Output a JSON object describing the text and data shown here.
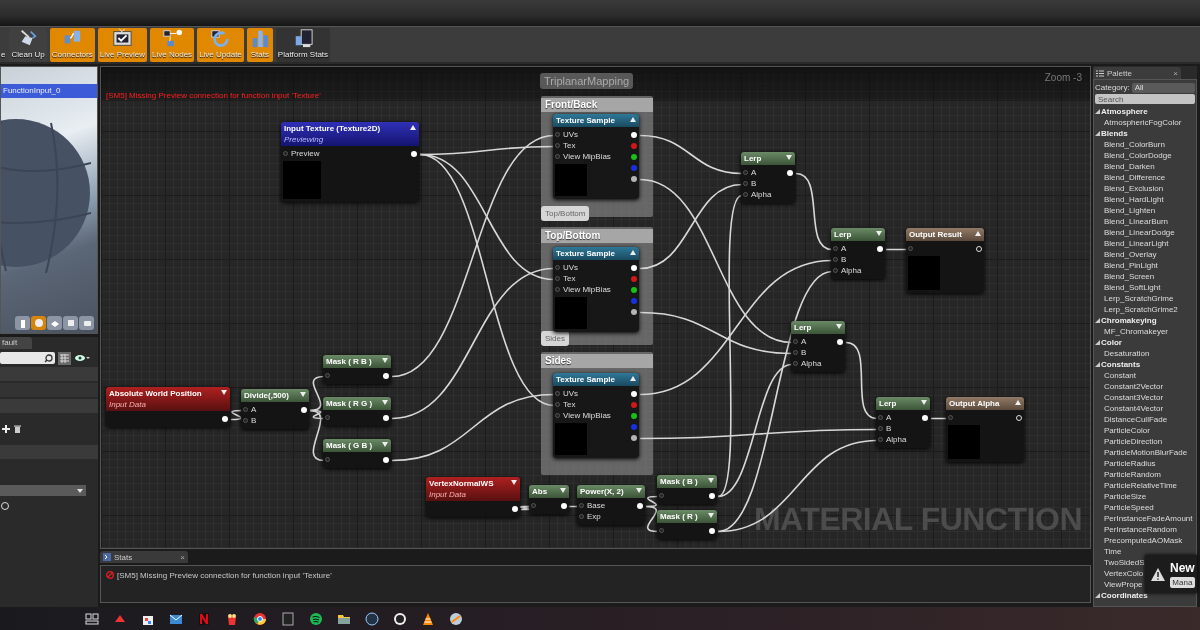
{
  "toolbar": {
    "buttons": [
      {
        "label": "e",
        "active": false
      },
      {
        "label": "Clean Up",
        "active": false
      },
      {
        "label": "Connectors",
        "active": true
      },
      {
        "label": "Live Preview",
        "active": true
      },
      {
        "label": "Live Nodes",
        "active": true
      },
      {
        "label": "Live Update",
        "active": true
      },
      {
        "label": "Stats",
        "active": true
      },
      {
        "label": "Platform Stats",
        "active": false
      }
    ]
  },
  "viewport": {
    "title": "FunctionInput_0",
    "view_modes": [
      {
        "selected": false
      },
      {
        "selected": true
      },
      {
        "selected": false
      },
      {
        "selected": false
      },
      {
        "selected": false
      }
    ]
  },
  "details": {
    "tab": "fault",
    "radio_selected": false
  },
  "graph": {
    "error": "[SM5] Missing Preview connection for function input 'Texture'",
    "zoom": "Zoom -3",
    "watermark": "MATERIAL FUNCTION",
    "group_title": "TriplanarMapping",
    "comments": [
      {
        "title": "Front/Back"
      },
      {
        "title": "Top/Bottom",
        "bubble": "Top/Bottom"
      },
      {
        "title": "Sides",
        "bubble": "Sides"
      }
    ],
    "nodes": [
      {
        "kind": "parameter",
        "title": "Input Texture (Texture2D)",
        "subtitle": "Previewing",
        "inputs": [
          "Preview"
        ]
      },
      {
        "kind": "texture",
        "title": "Texture Sample",
        "inputs": [
          "UVs",
          "Tex",
          "View MipBias"
        ],
        "outputs": [
          {
            "color": "#ffffff"
          },
          {
            "color": "#d01818"
          },
          {
            "color": "#18c018"
          },
          {
            "color": "#1830e0"
          },
          {
            "color": "#b4b4b4"
          }
        ]
      },
      {
        "kind": "math",
        "title": "Lerp",
        "inputs": [
          "A",
          "B",
          "Alpha"
        ]
      },
      {
        "kind": "texture",
        "title": "Texture Sample",
        "inputs": [
          "UVs",
          "Tex",
          "View MipBias"
        ],
        "outputs": [
          {
            "color": "#ffffff"
          },
          {
            "color": "#d01818"
          },
          {
            "color": "#18c018"
          },
          {
            "color": "#1830e0"
          },
          {
            "color": "#b4b4b4"
          }
        ]
      },
      {
        "kind": "math",
        "title": "Lerp",
        "inputs": [
          "A",
          "B",
          "Alpha"
        ]
      },
      {
        "kind": "output",
        "title": "Output Result"
      },
      {
        "kind": "math",
        "title": "Mask ( R B )"
      },
      {
        "kind": "math",
        "title": "Lerp",
        "inputs": [
          "A",
          "B",
          "Alpha"
        ]
      },
      {
        "kind": "input",
        "title": "Absolute World Position",
        "subtitle": "Input Data"
      },
      {
        "kind": "math",
        "title": "Divide(,500)",
        "inputs": [
          "A",
          "B"
        ]
      },
      {
        "kind": "math",
        "title": "Mask ( R G )"
      },
      {
        "kind": "math",
        "title": "Mask ( G B )"
      },
      {
        "kind": "texture",
        "title": "Texture Sample",
        "inputs": [
          "UVs",
          "Tex",
          "View MipBias"
        ],
        "outputs": [
          {
            "color": "#ffffff"
          },
          {
            "color": "#d01818"
          },
          {
            "color": "#18c018"
          },
          {
            "color": "#1830e0"
          },
          {
            "color": "#b4b4b4"
          }
        ]
      },
      {
        "kind": "math",
        "title": "Lerp",
        "inputs": [
          "A",
          "B",
          "Alpha"
        ]
      },
      {
        "kind": "output",
        "title": "Output Alpha"
      },
      {
        "kind": "input",
        "title": "VertexNormalWS",
        "subtitle": "Input Data"
      },
      {
        "kind": "math",
        "title": "Abs"
      },
      {
        "kind": "math",
        "title": "Power(X, 2)",
        "inputs": [
          "Base",
          "Exp"
        ]
      },
      {
        "kind": "math",
        "title": "Mask ( B )"
      },
      {
        "kind": "math",
        "title": "Mask ( R )"
      }
    ]
  },
  "log": {
    "tab": "Stats",
    "close": "×",
    "message": "[SM5] Missing Preview connection for function input 'Texture'"
  },
  "palette": {
    "tab": "Palette",
    "close": "×",
    "category_label": "Category:",
    "category": "All",
    "search_placeholder": "Search",
    "items": [
      {
        "label": "Atmosphere",
        "expanded": true,
        "children": [
          {
            "label": "AtmosphericFogColor"
          }
        ]
      },
      {
        "label": "Blends",
        "expanded": true,
        "children": [
          {
            "label": "Blend_ColorBurn"
          },
          {
            "label": "Blend_ColorDodge"
          },
          {
            "label": "Blend_Darken"
          },
          {
            "label": "Blend_Difference"
          },
          {
            "label": "Blend_Exclusion"
          },
          {
            "label": "Blend_HardLight"
          },
          {
            "label": "Blend_Lighten"
          },
          {
            "label": "Blend_LinearBurn"
          },
          {
            "label": "Blend_LinearDodge"
          },
          {
            "label": "Blend_LinearLight"
          },
          {
            "label": "Blend_Overlay"
          },
          {
            "label": "Blend_PinLight"
          },
          {
            "label": "Blend_Screen"
          },
          {
            "label": "Blend_SoftLight"
          },
          {
            "label": "Lerp_ScratchGrime"
          },
          {
            "label": "Lerp_ScratchGrime2"
          }
        ]
      },
      {
        "label": "Chromakeying",
        "expanded": true,
        "children": [
          {
            "label": "MF_Chromakeyer"
          }
        ]
      },
      {
        "label": "Color",
        "expanded": true,
        "children": [
          {
            "label": "Desaturation"
          }
        ]
      },
      {
        "label": "Constants",
        "expanded": true,
        "children": [
          {
            "label": "Constant"
          },
          {
            "label": "Constant2Vector"
          },
          {
            "label": "Constant3Vector"
          },
          {
            "label": "Constant4Vector"
          },
          {
            "label": "DistanceCullFade"
          },
          {
            "label": "ParticleColor"
          },
          {
            "label": "ParticleDirection"
          },
          {
            "label": "ParticleMotionBlurFade"
          },
          {
            "label": "ParticleRadius"
          },
          {
            "label": "ParticleRandom"
          },
          {
            "label": "ParticleRelativeTime"
          },
          {
            "label": "ParticleSize"
          },
          {
            "label": "ParticleSpeed"
          },
          {
            "label": "PerInstanceFadeAmount"
          },
          {
            "label": "PerInstanceRandom"
          },
          {
            "label": "PrecomputedAOMask"
          },
          {
            "label": "Time"
          },
          {
            "label": "TwoSidedS"
          },
          {
            "label": "VertexColo"
          },
          {
            "label": "ViewPrope"
          }
        ]
      },
      {
        "label": "Coordinates",
        "expanded": true
      }
    ]
  },
  "notification": {
    "title": "New",
    "button": "Mana"
  }
}
